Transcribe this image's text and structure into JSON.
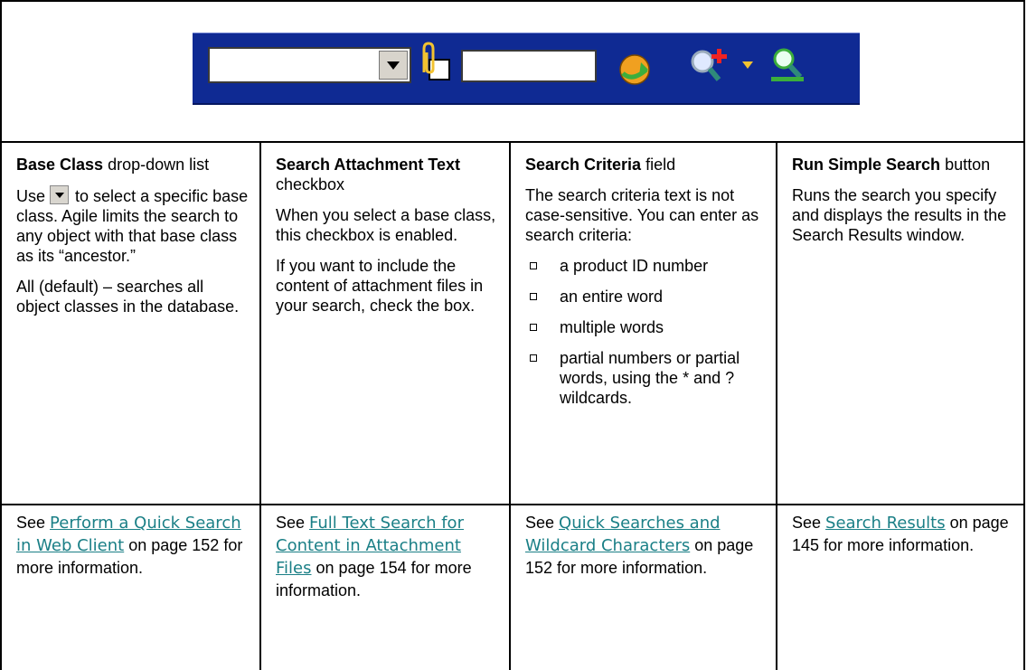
{
  "toolbar": {
    "icons": {
      "dropdown": "chevron-down-icon",
      "attachment": "paperclip-checkbox-icon",
      "run": "run-search-icon",
      "advanced": "advanced-search-icon",
      "caret": "caret-down-icon",
      "search": "search-icon"
    },
    "colors": {
      "background": "#0f2a93"
    }
  },
  "columns": [
    {
      "title": "Base Class",
      "title_suffix": " drop-down list",
      "p1_pre": "Use",
      "p1_post": " to select a specific base class. Agile limits the search to any object with that base class as its “ancestor.”",
      "p2": "All (default) – searches all object classes in the database.",
      "ref_pre": "See ",
      "ref_link": "Perform a Quick Search in Web Client",
      "ref_post": " on page 152 for more information."
    },
    {
      "title": "Search Attachment Text",
      "title_suffix": " checkbox",
      "p1": "When you select a base class, this checkbox is enabled.",
      "p2": "If you want to include the content of attachment files in your search, check the box.",
      "ref_pre": "See ",
      "ref_link": "Full Text Search for Content in Attachment Files",
      "ref_post": " on page 154  for more information."
    },
    {
      "title": "Search Criteria",
      "title_suffix": " field",
      "p1": "The search criteria text is not case-sensitive. You can enter as search criteria:",
      "bullets": [
        "a product ID number",
        "an entire word",
        "multiple words",
        "partial numbers or partial words, using the * and ? wildcards."
      ],
      "ref_pre": "See ",
      "ref_link": "Quick Searches and Wildcard Characters",
      "ref_post": " on page 152 for more information."
    },
    {
      "title": "Run Simple Search",
      "title_suffix": " button",
      "p1": "Runs the search you specify and displays the results in the Search Results window.",
      "ref_pre": "See ",
      "ref_link": "Search Results",
      "ref_post": " on page 145 for more information."
    }
  ]
}
